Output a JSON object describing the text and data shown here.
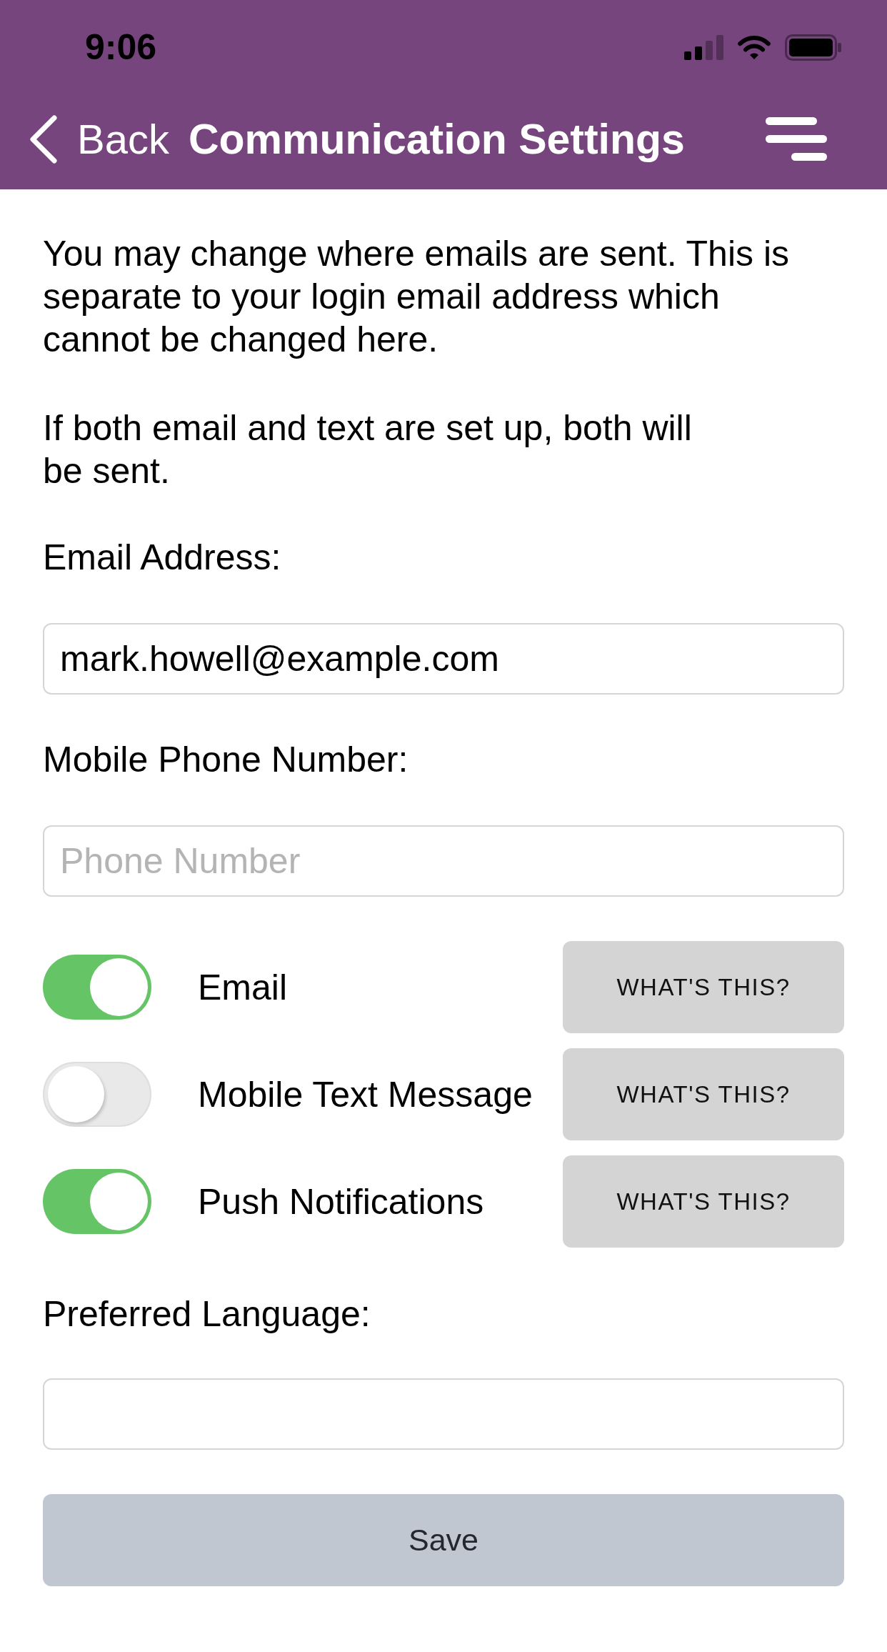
{
  "status_bar": {
    "time": "9:06"
  },
  "nav": {
    "back": "Back",
    "title": "Communication Settings"
  },
  "intro": [
    "You may change where emails are sent. This is separate to your login email address which cannot be changed here.",
    "If both email and text are set up, both will be sent."
  ],
  "fields": [
    {
      "label": "Email Address:",
      "value": "mark.howell@example.com"
    },
    {
      "label": "Mobile Phone Number:",
      "placeholder": "Phone Number"
    }
  ],
  "channels": [
    {
      "label": "Email",
      "on": true,
      "help": "WHAT'S THIS?"
    },
    {
      "label": "Mobile Text Message",
      "on": false,
      "help": "WHAT'S THIS?"
    },
    {
      "label": "Push Notifications",
      "on": true,
      "help": "WHAT'S THIS?"
    }
  ],
  "language": {
    "label": "Preferred Language:"
  },
  "save": "Save"
}
